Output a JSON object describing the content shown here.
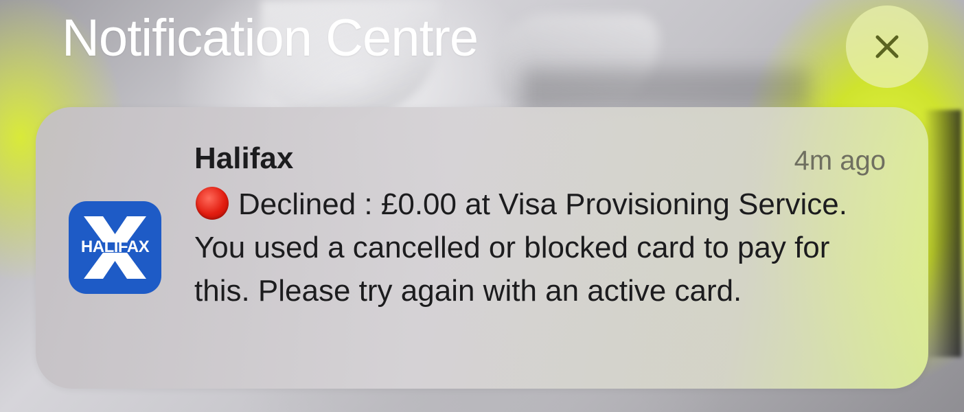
{
  "header": {
    "title": "Notification Centre",
    "close_icon": "close-icon"
  },
  "notification": {
    "app_name": "Halifax",
    "timestamp": "4m ago",
    "app_icon_label": "HALIFAX",
    "status_indicator": "red-circle-emoji",
    "message": "Declined : £0.00 at Visa Provisioning Service. You used a cancelled or blocked card to pay for this. Please try again with an active card."
  },
  "colors": {
    "app_icon_bg": "#1e5bc6",
    "close_button_bg": "#e8f0aa",
    "status_red": "#e21d10"
  }
}
